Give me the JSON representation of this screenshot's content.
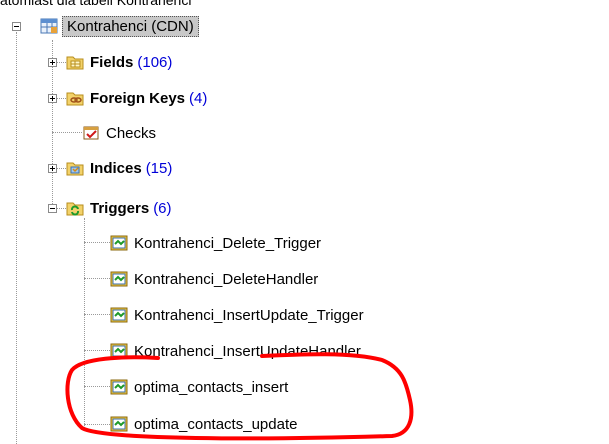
{
  "caption": "atomiast dla tabeli Kontrahenci",
  "colors": {
    "count_text": "#0000d8",
    "highlight": "#ff0000",
    "selected_bg": "#c8c8c8"
  },
  "tree": {
    "root": {
      "label": "Kontrahenci (CDN)",
      "icon": "table-icon",
      "expanded": true,
      "selected": true
    },
    "children": [
      {
        "label": "Fields",
        "count": "(106)",
        "icon": "fields-folder-icon",
        "bold": true,
        "expander": "plus"
      },
      {
        "label": "Foreign Keys",
        "count": "(4)",
        "icon": "foreign-keys-folder-icon",
        "bold": true,
        "expander": "plus"
      },
      {
        "label": "Checks",
        "icon": "checks-icon",
        "bold": false,
        "expander": "none"
      },
      {
        "label": "Indices",
        "count": "(15)",
        "icon": "indices-folder-icon",
        "bold": true,
        "expander": "plus"
      },
      {
        "label": "Triggers",
        "count": "(6)",
        "icon": "triggers-folder-icon",
        "bold": true,
        "expander": "minus"
      }
    ],
    "triggers": [
      "Kontrahenci_Delete_Trigger",
      "Kontrahenci_DeleteHandler",
      "Kontrahenci_InsertUpdate_Trigger",
      "Kontrahenci_InsertUpdateHandler",
      "optima_contacts_insert",
      "optima_contacts_update"
    ],
    "highlighted_triggers": [
      "optima_contacts_insert",
      "optima_contacts_update"
    ]
  }
}
